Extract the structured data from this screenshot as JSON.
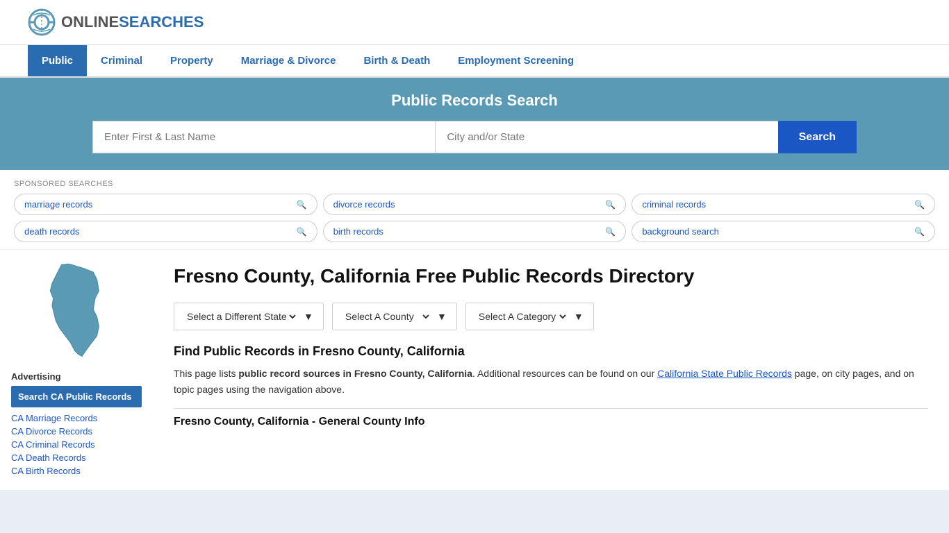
{
  "header": {
    "logo_text_online": "ONLINE",
    "logo_text_searches": "SEARCHES"
  },
  "nav": {
    "items": [
      {
        "label": "Public",
        "active": true
      },
      {
        "label": "Criminal",
        "active": false
      },
      {
        "label": "Property",
        "active": false
      },
      {
        "label": "Marriage & Divorce",
        "active": false
      },
      {
        "label": "Birth & Death",
        "active": false
      },
      {
        "label": "Employment Screening",
        "active": false
      }
    ]
  },
  "search_banner": {
    "title": "Public Records Search",
    "name_placeholder": "Enter First & Last Name",
    "location_placeholder": "City and/or State",
    "button_label": "Search"
  },
  "sponsored": {
    "label": "SPONSORED SEARCHES",
    "tags": [
      {
        "text": "marriage records"
      },
      {
        "text": "divorce records"
      },
      {
        "text": "criminal records"
      },
      {
        "text": "death records"
      },
      {
        "text": "birth records"
      },
      {
        "text": "background search"
      }
    ]
  },
  "content": {
    "page_title": "Fresno County, California Free Public Records Directory",
    "dropdown_state_label": "Select a Different State",
    "dropdown_county_label": "Select A County",
    "dropdown_category_label": "Select A Category",
    "find_title": "Find Public Records in Fresno County, California",
    "find_text_part1": "This page lists ",
    "find_text_bold": "public record sources in Fresno County, California",
    "find_text_part2": ". Additional resources can be found on our ",
    "find_link_text": "California State Public Records",
    "find_text_part3": " page, on city pages, and on topic pages using the navigation above.",
    "county_info_title": "Fresno County, California - General County Info"
  },
  "sidebar": {
    "advertising_label": "Advertising",
    "ad_button_label": "Search CA Public Records",
    "links": [
      {
        "text": "CA Marriage Records"
      },
      {
        "text": "CA Divorce Records"
      },
      {
        "text": "CA Criminal Records"
      },
      {
        "text": "CA Death Records"
      },
      {
        "text": "CA Birth Records"
      }
    ]
  }
}
